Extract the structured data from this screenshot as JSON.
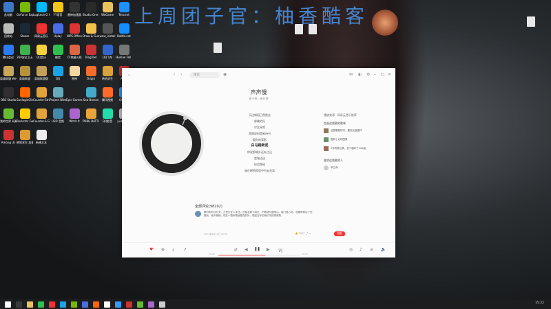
{
  "banner": "上周团子官：柚香酷客",
  "desktop_icons": [
    {
      "label": "此电脑",
      "color": "#3c78c8"
    },
    {
      "label": "GeForce Experience",
      "color": "#76b900"
    },
    {
      "label": "Logitech G HUB",
      "color": "#00b8fc"
    },
    {
      "label": "YY语音",
      "color": "#f5c518"
    },
    {
      "label": "雷神加速器",
      "color": "#333"
    },
    {
      "label": "Studio One 5",
      "color": "#2a2a2a"
    },
    {
      "label": "WeGame",
      "color": "#e8c25a"
    },
    {
      "label": "Tencent",
      "color": "#1e90ff"
    },
    {
      "label": "回收站",
      "color": "#bbbbbb"
    },
    {
      "label": "Steam",
      "color": "#1b2838"
    },
    {
      "label": "网易云音乐",
      "color": "#e33"
    },
    {
      "label": "Uplay",
      "color": "#4a6de5"
    },
    {
      "label": "WPS Office",
      "color": "#d33"
    },
    {
      "label": "Draw & Guess",
      "color": "#f3c14a"
    },
    {
      "label": "wow_install",
      "color": "#555"
    },
    {
      "label": "Battle.net",
      "color": "#148eff"
    },
    {
      "label": "腾讯会议",
      "color": "#2a7cf6"
    },
    {
      "label": "360安全卫士",
      "color": "#3fb24d"
    },
    {
      "label": "QQ音乐",
      "color": "#f6d33c"
    },
    {
      "label": "微信",
      "color": "#2fc14f"
    },
    {
      "label": "CF穿越火线",
      "color": "#d64"
    },
    {
      "label": "DiagTool",
      "color": "#c33"
    },
    {
      "label": "QQ飞车",
      "color": "#36c"
    },
    {
      "label": "Human Fall Flat",
      "color": "#777"
    },
    {
      "label": "英雄联盟 WeGame版",
      "color": "#c9a65a"
    },
    {
      "label": "英雄联盟",
      "color": "#b8913c"
    },
    {
      "label": "英雄联盟版",
      "color": "#c5a058"
    },
    {
      "label": "QQ",
      "color": "#1aa3e6"
    },
    {
      "label": "原神",
      "color": "#f4d6a0"
    },
    {
      "label": "Origin",
      "color": "#f56c2d"
    },
    {
      "label": "绝地求生",
      "color": "#d9a13b"
    },
    {
      "label": "Apex",
      "color": "#c33"
    },
    {
      "label": "OBS Studio",
      "color": "#302e31"
    },
    {
      "label": "SunloginClient",
      "color": "#f60"
    },
    {
      "label": "Counter-Strike",
      "color": "#e1a43a"
    },
    {
      "label": "Project Winter",
      "color": "#6ab"
    },
    {
      "label": "Epic Games Launcher",
      "color": "#222"
    },
    {
      "label": "Sea Breeze",
      "color": "#4ac"
    },
    {
      "label": "腾讯视频",
      "color": "#ff6a2a"
    },
    {
      "label": "QQ游戏",
      "color": "#39f"
    },
    {
      "label": "我的世界 网易版",
      "color": "#6b3"
    },
    {
      "label": "Rockstar Games",
      "color": "#fc0"
    },
    {
      "label": "Counter-S Global Off",
      "color": "#e1a43a"
    },
    {
      "label": "U3D 音频",
      "color": "#48a"
    },
    {
      "label": "Witch It",
      "color": "#a6c"
    },
    {
      "label": "PUBG BATTLEGR",
      "color": "#e8a33a"
    },
    {
      "label": "QQ影音",
      "color": "#2da"
    },
    {
      "label": "yuanshen",
      "color": "#ccc"
    },
    {
      "label": "Among Us",
      "color": "#c33"
    },
    {
      "label": "绝地求生 加速器",
      "color": "#d93"
    },
    {
      "label": "新建文本",
      "color": "#eee"
    }
  ],
  "player": {
    "search_placeholder": "搜索",
    "song_title": "声声慢",
    "song_sub": "崔子格 · 崔开潮",
    "lyrics": [
      "天边斜阳已然隐去",
      "那晚的归",
      "尔比寻常",
      "是情深但是被诗书",
      "看你的背影",
      "白马踏新泥",
      "你说那城外还有江山",
      "是城边送",
      "你用等候",
      "谁在断桥相思中行走无常"
    ],
    "active_lyric_index": 5,
    "side_heading": "播放来源 · 网易云音乐推荐",
    "similar_heading": "包含这首歌的歌单",
    "similar_items": [
      "这首歌超好听，建议反复循环",
      "国风 | 必听国风",
      "5年听歌记录，至少循环了100遍"
    ],
    "users_heading": "喜欢这首歌的人",
    "user_name": "甲乙丙",
    "comment_heading": "全部评论(98202)",
    "comment_text": "秦时明月汉时关，万里长征人未还。但使龙城飞将在，不教胡马度阴山。城门放心地，说要等等后了还是我，他不服输，现在一路听歌就是真的好，想起当年的我们听的那首歌。",
    "comment_time": "2021年6月12日 10:34",
    "comment_likes": "1293",
    "reply_label": "回复",
    "time_current": "00:42",
    "time_total": "04:30",
    "progress_fraction": 0.58
  },
  "taskbar": {
    "time": "15:22"
  }
}
